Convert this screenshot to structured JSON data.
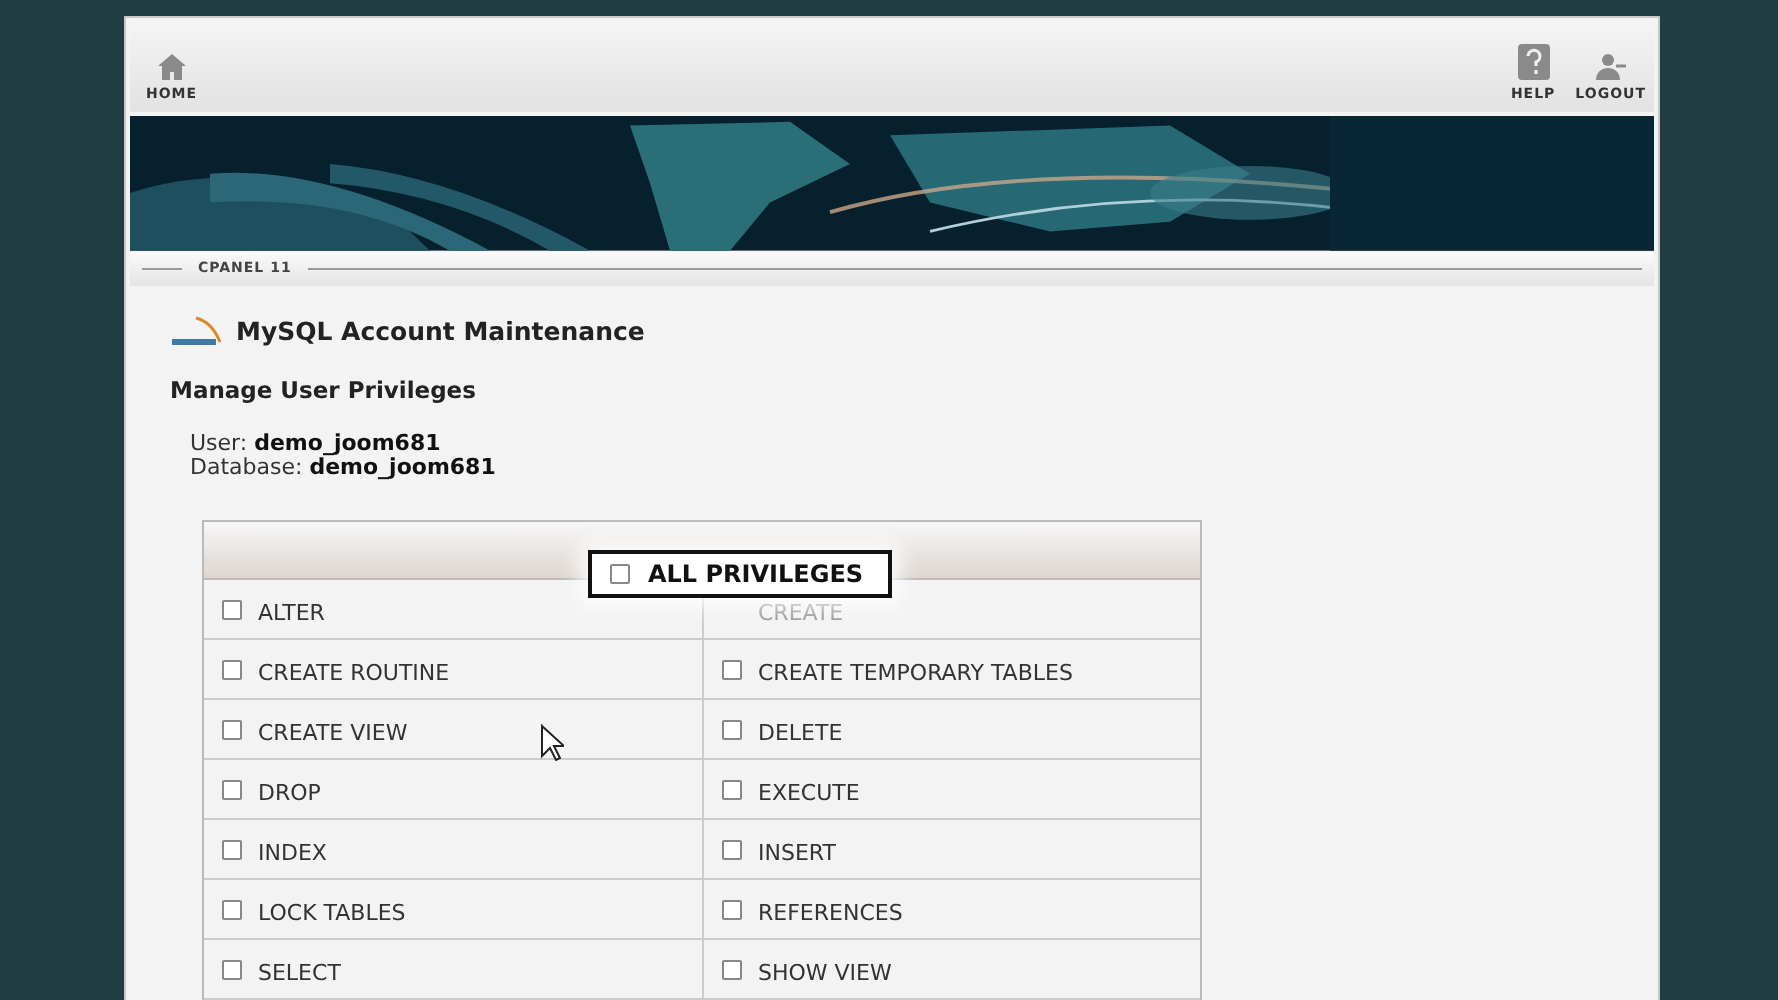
{
  "toolbar": {
    "left": [
      {
        "label": "HOME",
        "kind": "home"
      }
    ],
    "right": [
      {
        "label": "HELP",
        "kind": "help"
      },
      {
        "label": "LOGOUT",
        "kind": "logout"
      }
    ]
  },
  "breadcrumb": "CPANEL 11",
  "page_title": "MySQL Account Maintenance",
  "section_title": "Manage User Privileges",
  "user": {
    "label": "User:",
    "value": "demo_joom681"
  },
  "database": {
    "label": "Database:",
    "value": "demo_joom681"
  },
  "callout": {
    "label": "ALL PRIVILEGES",
    "checked": false
  },
  "privileges": [
    {
      "label": "ALTER",
      "checked": false
    },
    {
      "label": "CREATE"
    },
    {
      "label": "CREATE ROUTINE",
      "checked": false
    },
    {
      "label": "CREATE TEMPORARY TABLES",
      "checked": false
    },
    {
      "label": "CREATE VIEW",
      "checked": false
    },
    {
      "label": "DELETE",
      "checked": false
    },
    {
      "label": "DROP",
      "checked": false
    },
    {
      "label": "EXECUTE",
      "checked": false
    },
    {
      "label": "INDEX",
      "checked": false
    },
    {
      "label": "INSERT",
      "checked": false
    },
    {
      "label": "LOCK TABLES",
      "checked": false
    },
    {
      "label": "REFERENCES",
      "checked": false
    },
    {
      "label": "SELECT",
      "checked": false
    },
    {
      "label": "SHOW VIEW",
      "checked": false
    }
  ]
}
